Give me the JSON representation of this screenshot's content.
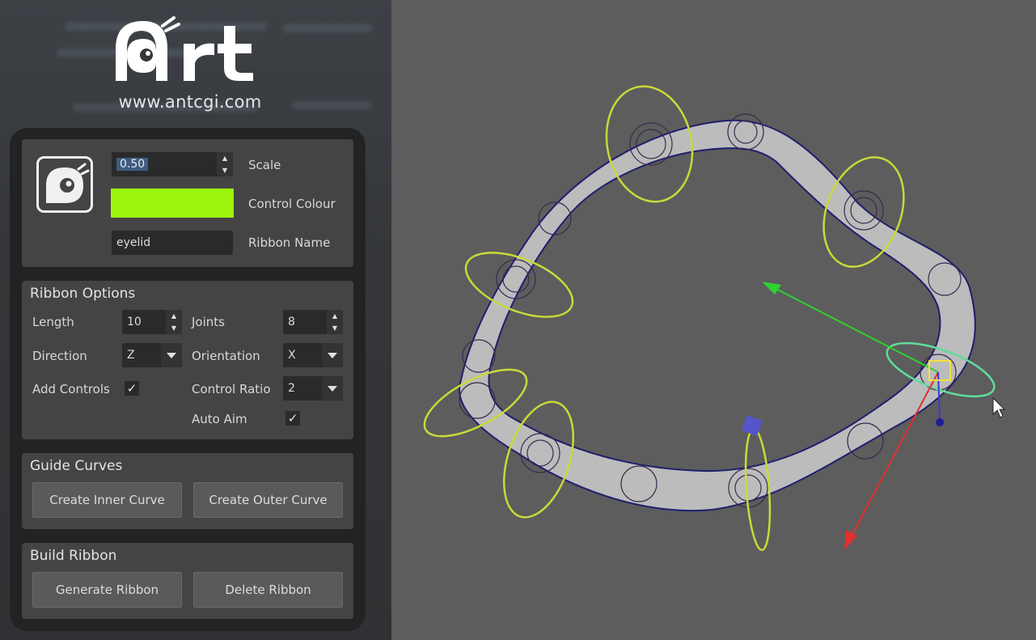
{
  "brand": {
    "logo_text": "Art",
    "url": "www.antcgi.com"
  },
  "top_panel": {
    "scale": {
      "value": "0.50",
      "label": "Scale"
    },
    "control_colour": {
      "value": "#9cf50a",
      "label": "Control Colour"
    },
    "ribbon_name": {
      "value": "eyelid",
      "label": "Ribbon Name"
    }
  },
  "ribbon_options": {
    "title": "Ribbon Options",
    "length": {
      "label": "Length",
      "value": "10"
    },
    "joints": {
      "label": "Joints",
      "value": "8"
    },
    "direction": {
      "label": "Direction",
      "value": "Z"
    },
    "orientation": {
      "label": "Orientation",
      "value": "X"
    },
    "add_controls": {
      "label": "Add Controls",
      "checked": true,
      "mark": "✓"
    },
    "control_ratio": {
      "label": "Control Ratio",
      "value": "2"
    },
    "auto_aim": {
      "label": "Auto Aim",
      "checked": true,
      "mark": "✓"
    }
  },
  "guide_curves": {
    "title": "Guide Curves",
    "inner_button": "Create Inner Curve",
    "outer_button": "Create Outer Curve"
  },
  "build_ribbon": {
    "title": "Build Ribbon",
    "generate_button": "Generate Ribbon",
    "delete_button": "Delete Ribbon"
  },
  "colors": {
    "control_ring": "#c9d93a",
    "selected_ring": "#5fdc9a",
    "axis_x": "#e23030",
    "axis_y": "#2fd02f",
    "axis_z": "#3a3ad0",
    "ribbon_surface": "#bdbdbd",
    "ribbon_edge": "#1f1f6e"
  }
}
